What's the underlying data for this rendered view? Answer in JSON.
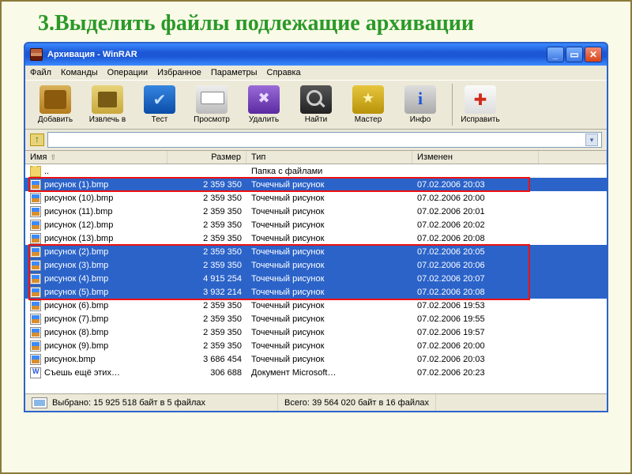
{
  "heading": "3.Выделить файлы  подлежащие архивации",
  "window_title": "Архивация - WinRAR",
  "menu": {
    "file": "Файл",
    "commands": "Команды",
    "operations": "Операции",
    "favorites": "Избранное",
    "options": "Параметры",
    "help": "Справка"
  },
  "toolbar": {
    "add": "Добавить",
    "extract": "Извлечь в",
    "test": "Тест",
    "view": "Просмотр",
    "delete": "Удалить",
    "find": "Найти",
    "wizard": "Мастер",
    "info": "Инфо",
    "repair": "Исправить"
  },
  "columns": {
    "name": "Имя",
    "size": "Размер",
    "type": "Тип",
    "modified": "Изменен"
  },
  "folder_row": {
    "type": "Папка с файлами"
  },
  "type_bmp": "Точечный рисунок",
  "type_doc": "Документ Microsoft…",
  "files": [
    {
      "name": "рисунок (1).bmp",
      "size": "2 359 350",
      "type": "bmp",
      "mod": "07.02.2006 20:03",
      "sel": true
    },
    {
      "name": "рисунок (10).bmp",
      "size": "2 359 350",
      "type": "bmp",
      "mod": "07.02.2006 20:00",
      "sel": false
    },
    {
      "name": "рисунок (11).bmp",
      "size": "2 359 350",
      "type": "bmp",
      "mod": "07.02.2006 20:01",
      "sel": false
    },
    {
      "name": "рисунок (12).bmp",
      "size": "2 359 350",
      "type": "bmp",
      "mod": "07.02.2006 20:02",
      "sel": false
    },
    {
      "name": "рисунок (13).bmp",
      "size": "2 359 350",
      "type": "bmp",
      "mod": "07.02.2006 20:08",
      "sel": false
    },
    {
      "name": "рисунок (2).bmp",
      "size": "2 359 350",
      "type": "bmp",
      "mod": "07.02.2006 20:05",
      "sel": true
    },
    {
      "name": "рисунок (3).bmp",
      "size": "2 359 350",
      "type": "bmp",
      "mod": "07.02.2006 20:06",
      "sel": true
    },
    {
      "name": "рисунок (4).bmp",
      "size": "4 915 254",
      "type": "bmp",
      "mod": "07.02.2006 20:07",
      "sel": true
    },
    {
      "name": "рисунок (5).bmp",
      "size": "3 932 214",
      "type": "bmp",
      "mod": "07.02.2006 20:08",
      "sel": true
    },
    {
      "name": "рисунок (6).bmp",
      "size": "2 359 350",
      "type": "bmp",
      "mod": "07.02.2006 19:53",
      "sel": false
    },
    {
      "name": "рисунок (7).bmp",
      "size": "2 359 350",
      "type": "bmp",
      "mod": "07.02.2006 19:55",
      "sel": false
    },
    {
      "name": "рисунок (8).bmp",
      "size": "2 359 350",
      "type": "bmp",
      "mod": "07.02.2006 19:57",
      "sel": false
    },
    {
      "name": "рисунок (9).bmp",
      "size": "2 359 350",
      "type": "bmp",
      "mod": "07.02.2006 20:00",
      "sel": false
    },
    {
      "name": "рисунок.bmp",
      "size": "3 686 454",
      "type": "bmp",
      "mod": "07.02.2006 20:03",
      "sel": false
    },
    {
      "name": "Съешь ещё этих…",
      "size": "306 688",
      "type": "doc",
      "mod": "07.02.2006 20:23",
      "sel": false
    }
  ],
  "status": {
    "selected": "Выбрано: 15 925 518 байт в 5 файлах",
    "total": "Всего: 39 564 020 байт в 16 файлах"
  }
}
